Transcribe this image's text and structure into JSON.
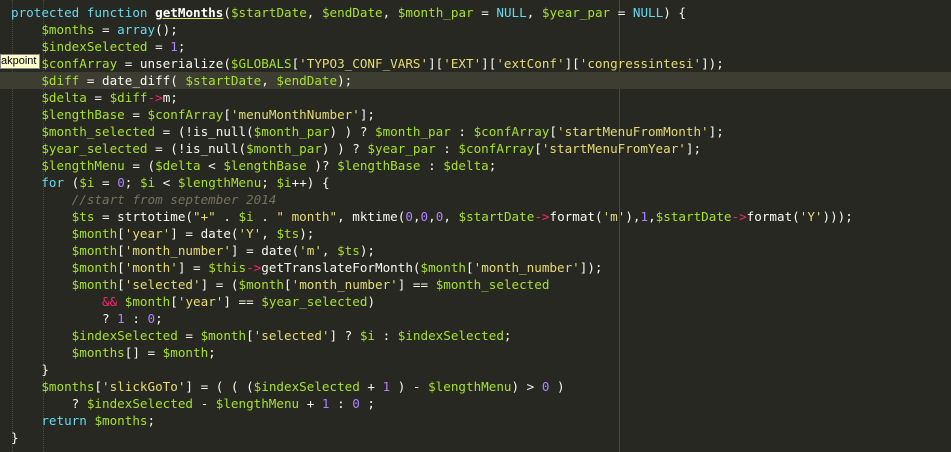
{
  "editor": {
    "breakpoint_tooltip": "akpoint",
    "colors": {
      "background": "#272822",
      "current_line": "#3E3D32",
      "keyword": "#66D9EF",
      "variable": "#A6E22E",
      "string": "#E6DB74",
      "number": "#AE81FF",
      "operator": "#F92672",
      "comment": "#75715E",
      "plain": "#F8F8F2"
    },
    "lines": [
      [
        [
          "kw",
          "protected"
        ],
        [
          "plain",
          " "
        ],
        [
          "kw",
          "function"
        ],
        [
          "plain",
          " "
        ],
        [
          "fn",
          "getMonths"
        ],
        [
          "plain",
          "("
        ],
        [
          "var",
          "$startDate"
        ],
        [
          "plain",
          ", "
        ],
        [
          "var",
          "$endDate"
        ],
        [
          "plain",
          ", "
        ],
        [
          "var",
          "$month_par"
        ],
        [
          "plain",
          " = "
        ],
        [
          "const",
          "NULL"
        ],
        [
          "plain",
          ", "
        ],
        [
          "var",
          "$year_par"
        ],
        [
          "plain",
          " = "
        ],
        [
          "const",
          "NULL"
        ],
        [
          "plain",
          ") {"
        ]
      ],
      [
        [
          "plain",
          "    "
        ],
        [
          "var",
          "$months"
        ],
        [
          "plain",
          " = "
        ],
        [
          "kw",
          "array"
        ],
        [
          "plain",
          "();"
        ]
      ],
      [
        [
          "plain",
          "    "
        ],
        [
          "var",
          "$indexSelected"
        ],
        [
          "plain",
          " = "
        ],
        [
          "num",
          "1"
        ],
        [
          "plain",
          ";"
        ]
      ],
      [
        [
          "plain",
          "    "
        ],
        [
          "var",
          "$confArray"
        ],
        [
          "plain",
          " = unserialize("
        ],
        [
          "var",
          "$GLOBALS"
        ],
        [
          "plain",
          "["
        ],
        [
          "str",
          "'TYPO3_CONF_VARS'"
        ],
        [
          "plain",
          "]["
        ],
        [
          "str",
          "'EXT'"
        ],
        [
          "plain",
          "]["
        ],
        [
          "str",
          "'extConf'"
        ],
        [
          "plain",
          "]["
        ],
        [
          "str",
          "'congressintesi'"
        ],
        [
          "plain",
          "]);"
        ]
      ],
      [
        [
          "plain",
          "    "
        ],
        [
          "var",
          "$diff"
        ],
        [
          "plain",
          " = date_diff( "
        ],
        [
          "var",
          "$startDate"
        ],
        [
          "plain",
          ", "
        ],
        [
          "var",
          "$endDate"
        ],
        [
          "plain",
          ");"
        ]
      ],
      [
        [
          "plain",
          "    "
        ],
        [
          "var",
          "$delta"
        ],
        [
          "plain",
          " = "
        ],
        [
          "var",
          "$diff"
        ],
        [
          "op",
          "->"
        ],
        [
          "plain",
          "m;"
        ]
      ],
      [
        [
          "plain",
          "    "
        ],
        [
          "var",
          "$lengthBase"
        ],
        [
          "plain",
          " = "
        ],
        [
          "var",
          "$confArray"
        ],
        [
          "plain",
          "["
        ],
        [
          "str",
          "'menuMonthNumber'"
        ],
        [
          "plain",
          "];"
        ]
      ],
      [
        [
          "plain",
          "    "
        ],
        [
          "var",
          "$month_selected"
        ],
        [
          "plain",
          " = (!is_null("
        ],
        [
          "var",
          "$month_par"
        ],
        [
          "plain",
          ") ) ? "
        ],
        [
          "var",
          "$month_par"
        ],
        [
          "plain",
          " : "
        ],
        [
          "var",
          "$confArray"
        ],
        [
          "plain",
          "["
        ],
        [
          "str",
          "'startMenuFromMonth'"
        ],
        [
          "plain",
          "];"
        ]
      ],
      [
        [
          "plain",
          "    "
        ],
        [
          "var",
          "$year_selected"
        ],
        [
          "plain",
          " = (!is_null("
        ],
        [
          "var",
          "$month_par"
        ],
        [
          "plain",
          ") ) ? "
        ],
        [
          "var",
          "$year_par"
        ],
        [
          "plain",
          " : "
        ],
        [
          "var",
          "$confArray"
        ],
        [
          "plain",
          "["
        ],
        [
          "str",
          "'startMenuFromYear'"
        ],
        [
          "plain",
          "];"
        ]
      ],
      [
        [
          "plain",
          "    "
        ],
        [
          "var",
          "$lengthMenu"
        ],
        [
          "plain",
          " = ("
        ],
        [
          "var",
          "$delta"
        ],
        [
          "plain",
          " < "
        ],
        [
          "var",
          "$lengthBase"
        ],
        [
          "plain",
          " )? "
        ],
        [
          "var",
          "$lengthBase"
        ],
        [
          "plain",
          " : "
        ],
        [
          "var",
          "$delta"
        ],
        [
          "plain",
          ";"
        ]
      ],
      [
        [
          "plain",
          "    "
        ],
        [
          "kw",
          "for"
        ],
        [
          "plain",
          " ("
        ],
        [
          "var",
          "$i"
        ],
        [
          "plain",
          " = "
        ],
        [
          "num",
          "0"
        ],
        [
          "plain",
          "; "
        ],
        [
          "var",
          "$i"
        ],
        [
          "plain",
          " < "
        ],
        [
          "var",
          "$lengthMenu"
        ],
        [
          "plain",
          "; "
        ],
        [
          "var",
          "$i"
        ],
        [
          "plain",
          "++) {"
        ]
      ],
      [
        [
          "plain",
          "        "
        ],
        [
          "cmt",
          "//start from september 2014"
        ]
      ],
      [
        [
          "plain",
          "        "
        ],
        [
          "var",
          "$ts"
        ],
        [
          "plain",
          " = strtotime("
        ],
        [
          "str",
          "\"+\""
        ],
        [
          "plain",
          " . "
        ],
        [
          "var",
          "$i"
        ],
        [
          "plain",
          " . "
        ],
        [
          "str",
          "\" month\""
        ],
        [
          "plain",
          ", mktime("
        ],
        [
          "num",
          "0"
        ],
        [
          "plain",
          ","
        ],
        [
          "num",
          "0"
        ],
        [
          "plain",
          ","
        ],
        [
          "num",
          "0"
        ],
        [
          "plain",
          ", "
        ],
        [
          "var",
          "$startDate"
        ],
        [
          "op",
          "->"
        ],
        [
          "plain",
          "format("
        ],
        [
          "str",
          "'m'"
        ],
        [
          "plain",
          "),"
        ],
        [
          "num",
          "1"
        ],
        [
          "plain",
          ","
        ],
        [
          "var",
          "$startDate"
        ],
        [
          "op",
          "->"
        ],
        [
          "plain",
          "format("
        ],
        [
          "str",
          "'Y'"
        ],
        [
          "plain",
          ")));"
        ]
      ],
      [
        [
          "plain",
          "        "
        ],
        [
          "var",
          "$month"
        ],
        [
          "plain",
          "["
        ],
        [
          "str",
          "'year'"
        ],
        [
          "plain",
          "] = date("
        ],
        [
          "str",
          "'Y'"
        ],
        [
          "plain",
          ", "
        ],
        [
          "var",
          "$ts"
        ],
        [
          "plain",
          ");"
        ]
      ],
      [
        [
          "plain",
          "        "
        ],
        [
          "var",
          "$month"
        ],
        [
          "plain",
          "["
        ],
        [
          "str",
          "'month_number'"
        ],
        [
          "plain",
          "] = date("
        ],
        [
          "str",
          "'m'"
        ],
        [
          "plain",
          ", "
        ],
        [
          "var",
          "$ts"
        ],
        [
          "plain",
          ");"
        ]
      ],
      [
        [
          "plain",
          "        "
        ],
        [
          "var",
          "$month"
        ],
        [
          "plain",
          "["
        ],
        [
          "str",
          "'month'"
        ],
        [
          "plain",
          "] = "
        ],
        [
          "var",
          "$this"
        ],
        [
          "op",
          "->"
        ],
        [
          "plain",
          "getTranslateForMonth("
        ],
        [
          "var",
          "$month"
        ],
        [
          "plain",
          "["
        ],
        [
          "str",
          "'month_number'"
        ],
        [
          "plain",
          "]);"
        ]
      ],
      [
        [
          "plain",
          "        "
        ],
        [
          "var",
          "$month"
        ],
        [
          "plain",
          "["
        ],
        [
          "str",
          "'selected'"
        ],
        [
          "plain",
          "] = ("
        ],
        [
          "var",
          "$month"
        ],
        [
          "plain",
          "["
        ],
        [
          "str",
          "'month_number'"
        ],
        [
          "plain",
          "] == "
        ],
        [
          "var",
          "$month_selected"
        ]
      ],
      [
        [
          "plain",
          "            "
        ],
        [
          "op",
          "&&"
        ],
        [
          "plain",
          " "
        ],
        [
          "var",
          "$month"
        ],
        [
          "plain",
          "["
        ],
        [
          "str",
          "'year'"
        ],
        [
          "plain",
          "] == "
        ],
        [
          "var",
          "$year_selected"
        ],
        [
          "plain",
          ")"
        ]
      ],
      [
        [
          "plain",
          "            ? "
        ],
        [
          "num",
          "1"
        ],
        [
          "plain",
          " : "
        ],
        [
          "num",
          "0"
        ],
        [
          "plain",
          ";"
        ]
      ],
      [
        [
          "plain",
          "        "
        ],
        [
          "var",
          "$indexSelected"
        ],
        [
          "plain",
          " = "
        ],
        [
          "var",
          "$month"
        ],
        [
          "plain",
          "["
        ],
        [
          "str",
          "'selected'"
        ],
        [
          "plain",
          "] ? "
        ],
        [
          "var",
          "$i"
        ],
        [
          "plain",
          " : "
        ],
        [
          "var",
          "$indexSelected"
        ],
        [
          "plain",
          ";"
        ]
      ],
      [
        [
          "plain",
          "        "
        ],
        [
          "var",
          "$months"
        ],
        [
          "plain",
          "[] = "
        ],
        [
          "var",
          "$month"
        ],
        [
          "plain",
          ";"
        ]
      ],
      [
        [
          "plain",
          "    }"
        ]
      ],
      [
        [
          "plain",
          "    "
        ],
        [
          "var",
          "$months"
        ],
        [
          "plain",
          "["
        ],
        [
          "str",
          "'slickGoTo'"
        ],
        [
          "plain",
          "] = ( ( ("
        ],
        [
          "var",
          "$indexSelected"
        ],
        [
          "plain",
          " + "
        ],
        [
          "num",
          "1"
        ],
        [
          "plain",
          " ) - "
        ],
        [
          "var",
          "$lengthMenu"
        ],
        [
          "plain",
          ") > "
        ],
        [
          "num",
          "0"
        ],
        [
          "plain",
          " )"
        ]
      ],
      [
        [
          "plain",
          "        ? "
        ],
        [
          "var",
          "$indexSelected"
        ],
        [
          "plain",
          " - "
        ],
        [
          "var",
          "$lengthMenu"
        ],
        [
          "plain",
          " + "
        ],
        [
          "num",
          "1"
        ],
        [
          "plain",
          " : "
        ],
        [
          "num",
          "0"
        ],
        [
          "plain",
          " ;"
        ]
      ],
      [
        [
          "plain",
          "    "
        ],
        [
          "kw",
          "return"
        ],
        [
          "plain",
          " "
        ],
        [
          "var",
          "$months"
        ],
        [
          "plain",
          ";"
        ]
      ],
      [
        [
          "plain",
          "}"
        ]
      ]
    ]
  }
}
